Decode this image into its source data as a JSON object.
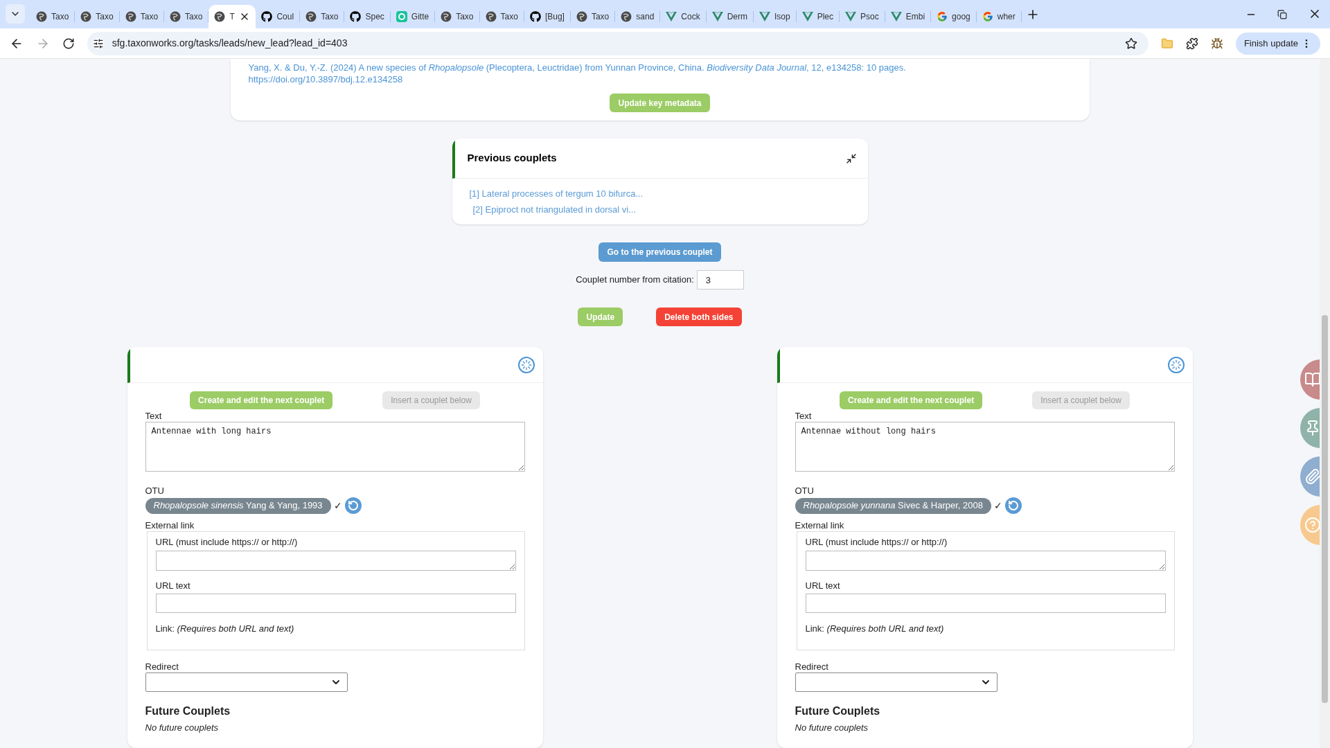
{
  "browser": {
    "tabs": [
      {
        "title": "Taxo",
        "kind": "globe",
        "selected": false
      },
      {
        "title": "Taxo",
        "kind": "globe",
        "selected": false
      },
      {
        "title": "Taxo",
        "kind": "globe",
        "selected": false
      },
      {
        "title": "Taxo",
        "kind": "globe",
        "selected": false
      },
      {
        "title": "T",
        "kind": "globe",
        "selected": true
      },
      {
        "title": "Coul",
        "kind": "github",
        "selected": false
      },
      {
        "title": "Taxo",
        "kind": "globe",
        "selected": false
      },
      {
        "title": "Spec",
        "kind": "github",
        "selected": false
      },
      {
        "title": "Gitte",
        "kind": "gitter",
        "selected": false
      },
      {
        "title": "Taxo",
        "kind": "globe",
        "selected": false
      },
      {
        "title": "Taxo",
        "kind": "globe",
        "selected": false
      },
      {
        "title": "[Bug]",
        "kind": "github",
        "selected": false
      },
      {
        "title": "Taxo",
        "kind": "globe",
        "selected": false
      },
      {
        "title": "sand",
        "kind": "globe",
        "selected": false
      },
      {
        "title": "Cock",
        "kind": "vue",
        "selected": false
      },
      {
        "title": "Derm",
        "kind": "vue",
        "selected": false
      },
      {
        "title": "Isop",
        "kind": "vue",
        "selected": false
      },
      {
        "title": "Plec",
        "kind": "vue",
        "selected": false
      },
      {
        "title": "Psoc",
        "kind": "vue",
        "selected": false
      },
      {
        "title": "Embi",
        "kind": "vue",
        "selected": false
      },
      {
        "title": "goog",
        "kind": "google",
        "selected": false
      },
      {
        "title": "wher",
        "kind": "google",
        "selected": false
      }
    ],
    "url": "sfg.taxonworks.org/tasks/leads/new_lead?lead_id=403",
    "update_button": "Finish update"
  },
  "citation": {
    "text": "Yang, X. & Du, Y.-Z. (2024) A new species of *Rhopalopsole* (Plecoptera, Leuctridae) from Yunnan Province, China. *Biodiversity Data Journal*, 12, e134258: 10 pages.",
    "doi": "https://doi.org/10.3897/bdj.12.e134258",
    "button": "Update key metadata"
  },
  "previous_couplets": {
    "title": "Previous couplets",
    "items": [
      "[1] Lateral processes of tergum 10 bifurca...",
      "[2] Epiproct not triangulated in dorsal vi..."
    ]
  },
  "previous_button": "Go to the previous couplet",
  "couplet_number": {
    "label": "Couplet number from citation:",
    "value": "3"
  },
  "actions": {
    "update": "Update",
    "delete": "Delete both sides"
  },
  "sides": [
    {
      "create_button": {
        "label": "Create and edit the next couplet",
        "disabled": false
      },
      "insert_button": {
        "label": "Insert a couplet below",
        "disabled": true
      },
      "text_label": "Text",
      "text": "Antennae with long hairs",
      "otu_label": "OTU",
      "otu": "*Rhopalopsole sinensis* Yang & Yang, 1993",
      "otu_check": "✓",
      "external_link_label": "External link",
      "url_label": "URL (must include https:// or http://)",
      "url_text_label": "URL text",
      "link_label": "Link:",
      "link_note": "(Requires both URL and text)",
      "redirect_label": "Redirect",
      "future_title": "Future Couplets",
      "future_note": "No future couplets"
    },
    {
      "create_button": {
        "label": "Create and edit the next couplet",
        "disabled": false
      },
      "insert_button": {
        "label": "Insert a couplet below",
        "disabled": true
      },
      "text_label": "Text",
      "text": "Antennae without long hairs",
      "otu_label": "OTU",
      "otu": "*Rhopalopsole yunnana* Sivec & Harper, 2008",
      "otu_check": "✓",
      "external_link_label": "External link",
      "url_label": "URL (must include https:// or http://)",
      "url_text_label": "URL text",
      "link_label": "Link:",
      "link_note": "(Requires both URL and text)",
      "redirect_label": "Redirect",
      "future_title": "Future Couplets",
      "future_note": "No future couplets"
    }
  ],
  "side_buttons": [
    {
      "kind": "book",
      "color": "#c88a8a"
    },
    {
      "kind": "pin",
      "color": "#8fb3a8"
    },
    {
      "kind": "clip",
      "color": "#8faed0"
    },
    {
      "kind": "help",
      "color": "#f8c98e"
    }
  ]
}
